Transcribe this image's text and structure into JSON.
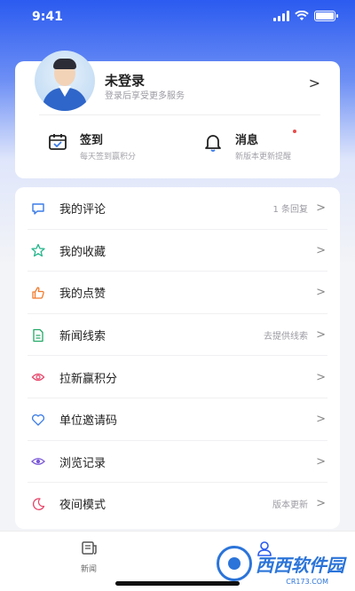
{
  "status_bar": {
    "time": "9:41"
  },
  "profile": {
    "title": "未登录",
    "subtitle": "登录后享受更多服务",
    "arrow": ">"
  },
  "quick_actions": {
    "signin": {
      "title": "签到",
      "subtitle": "每天签到赢积分"
    },
    "messages": {
      "title": "消息",
      "subtitle": "新版本更新提醒"
    }
  },
  "menu": [
    {
      "label": "我的评论",
      "hint": "1 条回复",
      "icon": "comment-icon",
      "color": "#3a7be8"
    },
    {
      "label": "我的收藏",
      "hint": "",
      "icon": "star-icon",
      "color": "#23b58a"
    },
    {
      "label": "我的点赞",
      "hint": "",
      "icon": "thumbs-up-icon",
      "color": "#f07a2c"
    },
    {
      "label": "新闻线索",
      "hint": "去提供线索",
      "icon": "document-icon",
      "color": "#23a966"
    },
    {
      "label": "拉新赢积分",
      "hint": "",
      "icon": "gift-icon",
      "color": "#e8476b"
    },
    {
      "label": "单位邀请码",
      "hint": "",
      "icon": "heart-icon",
      "color": "#3a7be8"
    },
    {
      "label": "浏览记录",
      "hint": "",
      "icon": "eye-icon",
      "color": "#7a58d8"
    },
    {
      "label": "夜间模式",
      "hint": "版本更新",
      "icon": "moon-icon",
      "color": "#e8476b"
    }
  ],
  "menu_arrow": ">",
  "tabbar": {
    "news": {
      "label": "新闻"
    },
    "me": {
      "label": ""
    }
  },
  "watermark": {
    "text": "西西软件园",
    "sub": "CR173.COM"
  },
  "colors": {
    "accent": "#2b5bf0",
    "background": "#f3f4f7"
  }
}
